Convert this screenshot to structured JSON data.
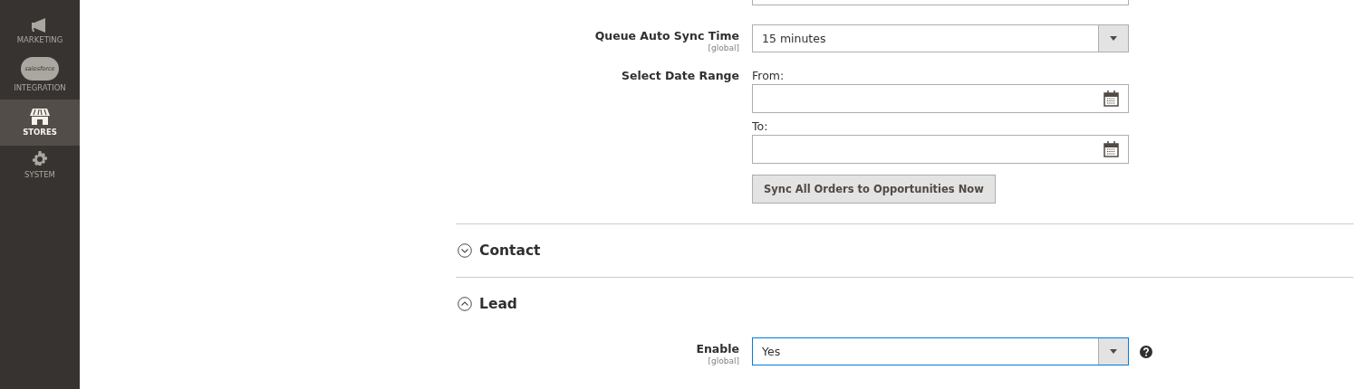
{
  "sidebar": {
    "items": [
      {
        "label": "MARKETING",
        "kind": "megaphone",
        "selected": false
      },
      {
        "label": "INTEGRATION",
        "kind": "cloud",
        "icon_text": "salesforce",
        "selected": false
      },
      {
        "label": "STORES",
        "kind": "store",
        "selected": true
      },
      {
        "label": "SYSTEM",
        "kind": "gear",
        "selected": false
      }
    ]
  },
  "fields": [
    {
      "kind": "clipped"
    },
    {
      "kind": "select",
      "label": "Queue Auto Sync Time",
      "scope": "[global]",
      "value": "15 minutes",
      "focused": false
    },
    {
      "kind": "date_range",
      "label": "Select Date Range",
      "from_label": "From:",
      "to_label": "To:"
    },
    {
      "kind": "button",
      "text": "Sync All Orders to Opportunities Now"
    }
  ],
  "sections": [
    {
      "title": "Contact",
      "expanded": false
    },
    {
      "title": "Lead",
      "expanded": true,
      "fields": [
        {
          "kind": "select",
          "label": "Enable",
          "scope": "[global]",
          "value": "Yes",
          "focused": true,
          "help": true
        }
      ]
    }
  ]
}
